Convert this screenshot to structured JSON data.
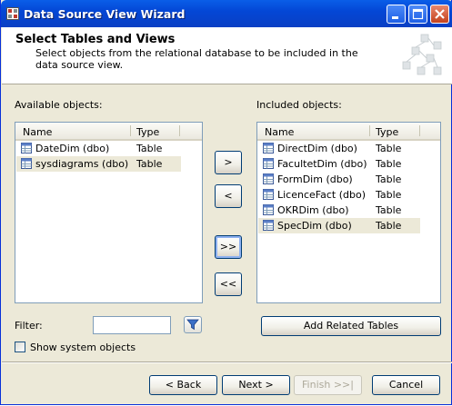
{
  "window": {
    "title": "Data Source View Wizard",
    "icon": "wizard-app-icon",
    "controls": [
      "minimize-icon",
      "maximize-icon",
      "close-icon"
    ]
  },
  "header": {
    "title": "Select Tables and Views",
    "description": "Select objects from the relational database to be included in the data source view."
  },
  "available": {
    "label": "Available objects:",
    "columns": [
      "Name",
      "Type"
    ],
    "rows": [
      {
        "name": "DateDim (dbo)",
        "type": "Table",
        "selected": false
      },
      {
        "name": "sysdiagrams (dbo)",
        "type": "Table",
        "selected": true
      }
    ]
  },
  "included": {
    "label": "Included objects:",
    "columns": [
      "Name",
      "Type"
    ],
    "rows": [
      {
        "name": "DirectDim (dbo)",
        "type": "Table",
        "selected": false
      },
      {
        "name": "FacultetDim (dbo)",
        "type": "Table",
        "selected": false
      },
      {
        "name": "FormDim (dbo)",
        "type": "Table",
        "selected": false
      },
      {
        "name": "LicenceFact (dbo)",
        "type": "Table",
        "selected": false
      },
      {
        "name": "OKRDim (dbo)",
        "type": "Table",
        "selected": false
      },
      {
        "name": "SpecDim (dbo)",
        "type": "Table",
        "selected": true
      }
    ]
  },
  "move_buttons": {
    "add": ">",
    "remove": "<",
    "add_all": ">>",
    "remove_all": "<<"
  },
  "filter": {
    "label": "Filter:",
    "value": "",
    "icon": "filter-icon"
  },
  "show_system": {
    "label": "Show system objects",
    "checked": false
  },
  "add_related_label": "Add Related Tables",
  "footer": {
    "back": "< Back",
    "next": "Next >",
    "finish": "Finish >>|",
    "cancel": "Cancel"
  },
  "colors": {
    "titlebar": "#0a5ee8",
    "dialog_bg": "#ece9d8",
    "selected_row": "#ece9d8",
    "list_border": "#7f9db9"
  }
}
